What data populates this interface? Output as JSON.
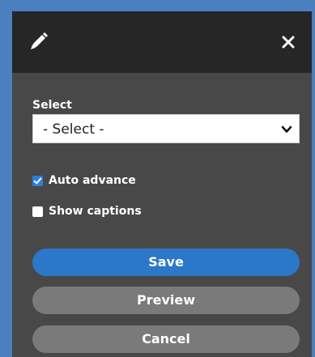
{
  "dialog": {
    "header_icon": "pencil-icon",
    "close_icon": "close-icon"
  },
  "form": {
    "select_label": "Select",
    "select_value": "- Select -",
    "auto_advance": {
      "label": "Auto advance",
      "checked": true
    },
    "show_captions": {
      "label": "Show captions",
      "checked": false
    }
  },
  "buttons": {
    "save": "Save",
    "preview": "Preview",
    "cancel": "Cancel"
  },
  "colors": {
    "background": "#4a80c0",
    "header": "#262626",
    "panel": "#484848",
    "primary_button": "#2b78c8",
    "secondary_button": "#7a7a7a",
    "checkbox_checked": "#2a7fe6"
  }
}
